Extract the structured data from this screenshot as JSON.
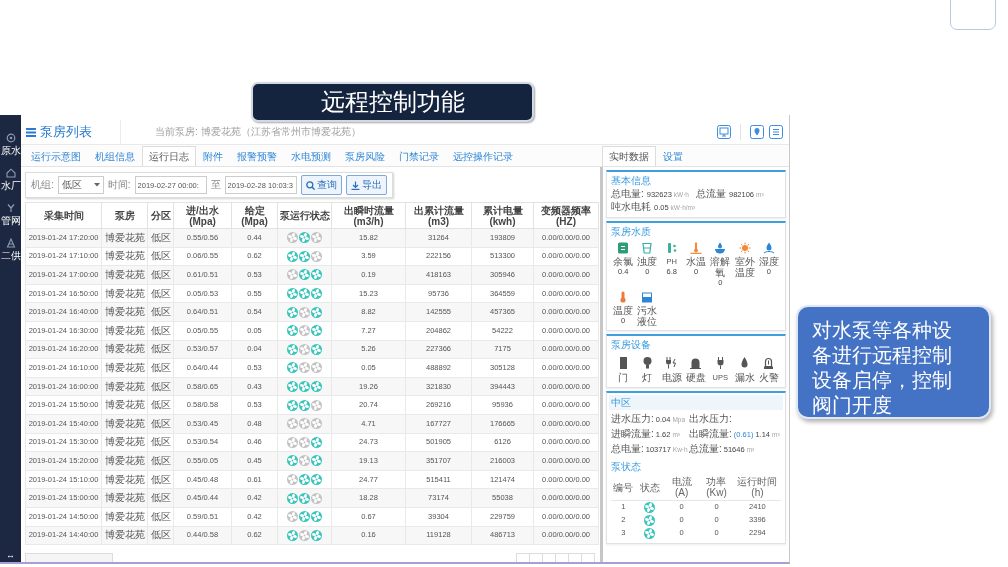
{
  "title_banner": "远程控制功能",
  "callout": "对水泵等各种设备进行远程控制设备启停，控制阀门开度",
  "sidebar": {
    "items": [
      {
        "label": "原水",
        "kind": "raw_water"
      },
      {
        "label": "水厂",
        "kind": "plant"
      },
      {
        "label": "管网",
        "kind": "network"
      },
      {
        "label": "二供",
        "kind": "supply"
      }
    ],
    "toggle": "↔"
  },
  "header": {
    "title": "泵房列表",
    "station": "当前泵房: 博爱花苑（江苏省常州市博爱花苑）"
  },
  "tabs": [
    {
      "label": "运行示意图",
      "selected": false
    },
    {
      "label": "机组信息",
      "selected": false
    },
    {
      "label": "运行日志",
      "selected": true
    },
    {
      "label": "附件",
      "selected": false
    },
    {
      "label": "报警预警",
      "selected": false
    },
    {
      "label": "水电预测",
      "selected": false
    },
    {
      "label": "泵房风险",
      "selected": false
    },
    {
      "label": "门禁记录",
      "selected": false
    },
    {
      "label": "远控操作记录",
      "selected": false
    }
  ],
  "filter": {
    "unit_label": "机组:",
    "unit_value": "低区",
    "time_label": "时间:",
    "start": "2019-02-27 00:00:",
    "range_label": "至",
    "end": "2019-02-28 10:03:3",
    "buttons": [
      {
        "label": "查询",
        "kind": "search"
      },
      {
        "label": "导出",
        "kind": "export"
      }
    ]
  },
  "table": {
    "columns": [
      "采集时间",
      "泵房",
      "分区",
      "进/出水(Mpa)",
      "给定(Mpa)",
      "泵运行状态",
      "出瞬时流量(m3/h)",
      "出累计流量(m3)",
      "累计电量(kwh)",
      "变频器频率(HZ)"
    ],
    "rows": [
      {
        "time": "2019-01-24 17:20:00",
        "station": "博爱花苑",
        "zone": "低区",
        "in_out": "0.55/0.56",
        "setpoint": "0.44",
        "pumps": [
          {
            "running": false
          },
          {
            "running": true
          },
          {
            "running": false
          }
        ],
        "flow": "15.82",
        "total_flow": "31264",
        "energy": "193809",
        "frequency": "0.00/0.00/0.00"
      },
      {
        "time": "2019-01-24 17:10:00",
        "station": "博爱花苑",
        "zone": "低区",
        "in_out": "0.06/0.55",
        "setpoint": "0.62",
        "pumps": [
          {
            "running": true
          },
          {
            "running": true
          },
          {
            "running": false
          }
        ],
        "flow": "3.59",
        "total_flow": "222156",
        "energy": "513300",
        "frequency": "0.00/0.00/0.00"
      },
      {
        "time": "2019-01-24 17:00:00",
        "station": "博爱花苑",
        "zone": "低区",
        "in_out": "0.61/0.51",
        "setpoint": "0.53",
        "pumps": [
          {
            "running": false
          },
          {
            "running": true
          },
          {
            "running": true
          }
        ],
        "flow": "0.19",
        "total_flow": "418163",
        "energy": "305946",
        "frequency": "0.00/0.00/0.00"
      },
      {
        "time": "2019-01-24 16:50:00",
        "station": "博爱花苑",
        "zone": "低区",
        "in_out": "0.05/0.53",
        "setpoint": "0.55",
        "pumps": [
          {
            "running": true
          },
          {
            "running": true
          },
          {
            "running": true
          }
        ],
        "flow": "15.23",
        "total_flow": "95736",
        "energy": "364559",
        "frequency": "0.00/0.00/0.00"
      },
      {
        "time": "2019-01-24 16:40:00",
        "station": "博爱花苑",
        "zone": "低区",
        "in_out": "0.64/0.51",
        "setpoint": "0.54",
        "pumps": [
          {
            "running": true
          },
          {
            "running": false
          },
          {
            "running": true
          }
        ],
        "flow": "8.82",
        "total_flow": "142555",
        "energy": "457365",
        "frequency": "0.00/0.00/0.00"
      },
      {
        "time": "2019-01-24 16:30:00",
        "station": "博爱花苑",
        "zone": "低区",
        "in_out": "0.05/0.55",
        "setpoint": "0.05",
        "pumps": [
          {
            "running": true
          },
          {
            "running": false
          },
          {
            "running": true
          }
        ],
        "flow": "7.27",
        "total_flow": "204862",
        "energy": "54222",
        "frequency": "0.00/0.00/0.00"
      },
      {
        "time": "2019-01-24 16:20:00",
        "station": "博爱花苑",
        "zone": "低区",
        "in_out": "0.53/0.57",
        "setpoint": "0.04",
        "pumps": [
          {
            "running": true
          },
          {
            "running": false
          },
          {
            "running": true
          }
        ],
        "flow": "5.26",
        "total_flow": "227366",
        "energy": "7175",
        "frequency": "0.00/0.00/0.00"
      },
      {
        "time": "2019-01-24 16:10:00",
        "station": "博爱花苑",
        "zone": "低区",
        "in_out": "0.64/0.44",
        "setpoint": "0.53",
        "pumps": [
          {
            "running": true
          },
          {
            "running": false
          },
          {
            "running": false
          }
        ],
        "flow": "0.05",
        "total_flow": "488892",
        "energy": "305128",
        "frequency": "0.00/0.00/0.00"
      },
      {
        "time": "2019-01-24 16:00:00",
        "station": "博爱花苑",
        "zone": "低区",
        "in_out": "0.58/0.65",
        "setpoint": "0.43",
        "pumps": [
          {
            "running": true
          },
          {
            "running": true
          },
          {
            "running": true
          }
        ],
        "flow": "19.26",
        "total_flow": "321830",
        "energy": "394443",
        "frequency": "0.00/0.00/0.00"
      },
      {
        "time": "2019-01-24 15:50:00",
        "station": "博爱花苑",
        "zone": "低区",
        "in_out": "0.58/0.58",
        "setpoint": "0.53",
        "pumps": [
          {
            "running": true
          },
          {
            "running": true
          },
          {
            "running": false
          }
        ],
        "flow": "20.74",
        "total_flow": "269216",
        "energy": "95936",
        "frequency": "0.00/0.00/0.00"
      },
      {
        "time": "2019-01-24 15:40:00",
        "station": "博爱花苑",
        "zone": "低区",
        "in_out": "0.53/0.45",
        "setpoint": "0.48",
        "pumps": [
          {
            "running": false
          },
          {
            "running": false
          },
          {
            "running": false
          }
        ],
        "flow": "4.71",
        "total_flow": "167727",
        "energy": "176665",
        "frequency": "0.00/0.00/0.00"
      },
      {
        "time": "2019-01-24 15:30:00",
        "station": "博爱花苑",
        "zone": "低区",
        "in_out": "0.53/0.54",
        "setpoint": "0.46",
        "pumps": [
          {
            "running": false
          },
          {
            "running": false
          },
          {
            "running": true
          }
        ],
        "flow": "24.73",
        "total_flow": "501905",
        "energy": "6126",
        "frequency": "0.00/0.00/0.00"
      },
      {
        "time": "2019-01-24 15:20:00",
        "station": "博爱花苑",
        "zone": "低区",
        "in_out": "0.55/0.05",
        "setpoint": "0.45",
        "pumps": [
          {
            "running": true
          },
          {
            "running": false
          },
          {
            "running": true
          }
        ],
        "flow": "19.13",
        "total_flow": "351707",
        "energy": "216003",
        "frequency": "0.00/0.00/0.00"
      },
      {
        "time": "2019-01-24 15:10:00",
        "station": "博爱花苑",
        "zone": "低区",
        "in_out": "0.45/0.48",
        "setpoint": "0.61",
        "pumps": [
          {
            "running": false
          },
          {
            "running": true
          },
          {
            "running": true
          }
        ],
        "flow": "24.77",
        "total_flow": "515411",
        "energy": "121474",
        "frequency": "0.00/0.00/0.00"
      },
      {
        "time": "2019-01-24 15:00:00",
        "station": "博爱花苑",
        "zone": "低区",
        "in_out": "0.45/0.44",
        "setpoint": "0.42",
        "pumps": [
          {
            "running": true
          },
          {
            "running": true
          },
          {
            "running": false
          }
        ],
        "flow": "18.28",
        "total_flow": "73174",
        "energy": "55038",
        "frequency": "0.00/0.00/0.00"
      },
      {
        "time": "2019-01-24 14:50:00",
        "station": "博爱花苑",
        "zone": "低区",
        "in_out": "0.59/0.51",
        "setpoint": "0.42",
        "pumps": [
          {
            "running": false
          },
          {
            "running": true
          },
          {
            "running": true
          }
        ],
        "flow": "0.67",
        "total_flow": "39304",
        "energy": "229759",
        "frequency": "0.00/0.00/0.00"
      },
      {
        "time": "2019-01-24 14:40:00",
        "station": "博爱花苑",
        "zone": "低区",
        "in_out": "0.44/0.58",
        "setpoint": "0.62",
        "pumps": [
          {
            "running": true
          },
          {
            "running": false
          },
          {
            "running": true
          }
        ],
        "flow": "0.16",
        "total_flow": "119128",
        "energy": "486713",
        "frequency": "0.00/0.00/0.00"
      }
    ]
  },
  "right_tabs": [
    {
      "label": "实时数据",
      "selected": true
    },
    {
      "label": "设置",
      "selected": false
    }
  ],
  "basic_info": {
    "title": "基本信息",
    "items": [
      {
        "label": "总电量:",
        "value": "932623",
        "unit": "kW·h"
      },
      {
        "label": "总流量",
        "value": "982106",
        "unit": "m³"
      },
      {
        "label": "吨水电耗",
        "value": "0.05",
        "unit": "kW·h/m³"
      }
    ]
  },
  "water_quality": {
    "title": "泵房水质",
    "items": [
      {
        "label": "余氯",
        "value": "0.4",
        "kind": "chlorine"
      },
      {
        "label": "浊度",
        "value": "0",
        "kind": "turbidity"
      },
      {
        "label": "PH",
        "value": "6.8",
        "kind": "ph"
      },
      {
        "label": "水温",
        "value": "0",
        "kind": "water_temp"
      },
      {
        "label": "溶解氧",
        "value": "0",
        "kind": "oxygen"
      },
      {
        "label": "室外温度",
        "kind": "outdoor_temp"
      },
      {
        "label": "湿度",
        "value": "0",
        "kind": "humidity"
      },
      {
        "label": "温度",
        "value": "0",
        "kind": "temperature"
      },
      {
        "label": "污水液位",
        "kind": "level"
      }
    ]
  },
  "devices": {
    "title": "泵房设备",
    "items": [
      {
        "label": "门",
        "kind": "door"
      },
      {
        "label": "灯",
        "kind": "lamp"
      },
      {
        "label": "电源",
        "kind": "power"
      },
      {
        "label": "硬盘",
        "kind": "disk"
      },
      {
        "label": "UPS",
        "kind": "ups"
      },
      {
        "label": "漏水",
        "kind": "leak"
      },
      {
        "label": "火警",
        "kind": "fire"
      }
    ]
  },
  "zone": {
    "title": "中区",
    "fields": [
      {
        "label": "进水压力:",
        "value": "0.04",
        "unit": "Mpa"
      },
      {
        "label": "出水压力:"
      },
      {
        "label": "进瞬流量:",
        "value": "1.62",
        "unit": "m³"
      },
      {
        "label": "出瞬流量:",
        "setpoint": "(0.61)",
        "value": "1.14",
        "unit": "m³"
      },
      {
        "label": "总电量:",
        "value": "103717",
        "unit": "Kw·h"
      },
      {
        "label": "总流量:",
        "value": "51646",
        "unit": "m³"
      }
    ],
    "pump_title": "泵状态",
    "pump_columns": [
      {
        "label": "编号"
      },
      {
        "label": "状态"
      },
      {
        "label": "电流",
        "unit": "(A)"
      },
      {
        "label": "功率",
        "unit": "(Kw)"
      },
      {
        "label": "运行时间",
        "unit": "(h)"
      }
    ],
    "pumps": [
      {
        "id": "1",
        "running": true,
        "current": "0",
        "power": "0",
        "hours": "2410"
      },
      {
        "id": "2",
        "running": true,
        "current": "0",
        "power": "0",
        "hours": "3396"
      },
      {
        "id": "3",
        "running": true,
        "current": "0",
        "power": "0",
        "hours": "2294"
      }
    ]
  }
}
